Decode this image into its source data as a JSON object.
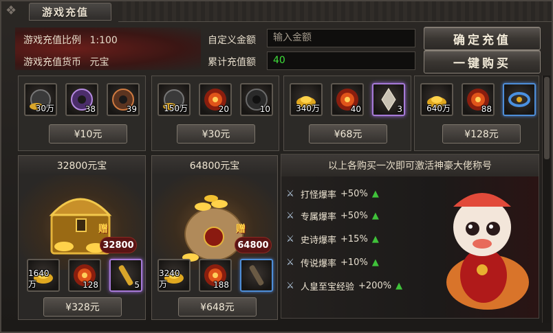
{
  "window": {
    "title": "游戏充值"
  },
  "info": {
    "ratio_label": "游戏充值比例",
    "ratio_value": "1:100",
    "currency_label": "游戏充值货币",
    "currency_value": "元宝",
    "custom_label": "自定义金额",
    "custom_placeholder": "输入金额",
    "total_label": "累计充值额",
    "total_value": "40"
  },
  "buttons": {
    "confirm": "确定充值",
    "buy_all": "一键购买"
  },
  "top_packages": [
    {
      "price": "¥10元",
      "items": [
        {
          "icon": "coin-icon",
          "qty": "30万"
        },
        {
          "icon": "gem-icon",
          "qty": "38"
        },
        {
          "icon": "gem-icon",
          "qty": "39"
        }
      ]
    },
    {
      "price": "¥30元",
      "items": [
        {
          "icon": "coin-icon",
          "qty": "150万"
        },
        {
          "icon": "fire-orb-icon",
          "qty": "20"
        },
        {
          "icon": "dark-orb-icon",
          "qty": "10"
        }
      ]
    },
    {
      "price": "¥68元",
      "items": [
        {
          "icon": "gold-ingot-icon",
          "qty": "340万"
        },
        {
          "icon": "fire-orb-icon",
          "qty": "40"
        },
        {
          "icon": "crystal-icon",
          "qty": "3"
        }
      ]
    },
    {
      "price": "¥128元",
      "items": [
        {
          "icon": "gold-ingot-icon",
          "qty": "640万"
        },
        {
          "icon": "fire-orb-icon",
          "qty": "88"
        },
        {
          "icon": "blue-ring-icon",
          "qty": ""
        }
      ]
    }
  ],
  "big_packages": [
    {
      "title": "32800元宝",
      "gift_label": "赠",
      "gift_amount": "32800",
      "price": "¥328元",
      "items": [
        {
          "icon": "gold-ingot-icon",
          "qty": "1640万"
        },
        {
          "icon": "fire-orb-icon",
          "qty": "128"
        },
        {
          "icon": "scroll-icon",
          "qty": "5"
        }
      ]
    },
    {
      "title": "64800元宝",
      "gift_label": "赠",
      "gift_amount": "64800",
      "price": "¥648元",
      "items": [
        {
          "icon": "gold-ingot-icon",
          "qty": "3240万"
        },
        {
          "icon": "fire-orb-icon",
          "qty": "188"
        },
        {
          "icon": "scroll-icon",
          "qty": ""
        }
      ]
    }
  ],
  "benefits": {
    "title": "以上各购买一次即可激活神豪大佬称号",
    "items": [
      {
        "label": "打怪爆率",
        "value": "+50%"
      },
      {
        "label": "专属爆率",
        "value": "+50%"
      },
      {
        "label": "史诗爆率",
        "value": "+15%"
      },
      {
        "label": "传说爆率",
        "value": "+10%"
      },
      {
        "label": "人皇至宝经验",
        "value": "+200%"
      }
    ]
  },
  "colors": {
    "accent_green": "#3fc23a",
    "gold": "#ffd447",
    "input_bg": "#0f0e0d"
  }
}
